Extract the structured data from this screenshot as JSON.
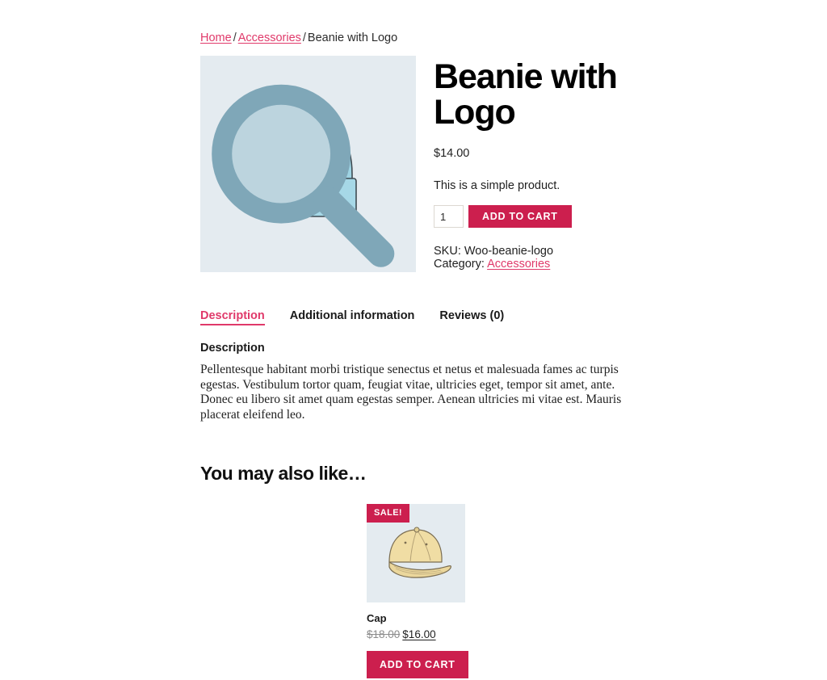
{
  "theme": {
    "accent": "#cc1f4e",
    "link": "#e0396a",
    "image_bg": "#e4ebf0",
    "page_bg": "#ffffff",
    "text": "#1a1a1a"
  },
  "breadcrumb": {
    "home": "Home",
    "category": "Accessories",
    "separator": "/",
    "current": "Beanie with Logo"
  },
  "gallery": {
    "zoom_icon": "magnifier-icon",
    "image_alt": "Beanie with Logo"
  },
  "product": {
    "title": "Beanie with Logo",
    "price": "$14.00",
    "short_description": "This is a simple product.",
    "quantity": "1",
    "quantity_placeholder": "1",
    "add_to_cart_label": "ADD TO CART",
    "meta_sku": "SKU: Woo-beanie-logo Category:",
    "meta_category_link": "Accessories"
  },
  "tabs": [
    {
      "label": "Description",
      "active": true
    },
    {
      "label": "Additional information",
      "active": false
    },
    {
      "label": "Reviews (0)",
      "active": false
    }
  ],
  "description_panel": {
    "heading": "Description",
    "body": "Pellentesque habitant morbi tristique senectus et netus et malesuada fames ac turpis egestas. Vestibulum tortor quam, feugiat vitae, ultricies eget, tempor sit amet, ante. Donec eu libero sit amet quam egestas semper. Aenean ultricies mi vitae est. Mauris placerat eleifend leo."
  },
  "related": {
    "heading": "You may also like…",
    "products": [
      {
        "badge": "SALE!",
        "name": "Cap",
        "regular_price": "$18.00",
        "sale_price": "$16.00",
        "add_to_cart_label": "ADD TO CART",
        "image_alt": "Cap"
      }
    ]
  }
}
